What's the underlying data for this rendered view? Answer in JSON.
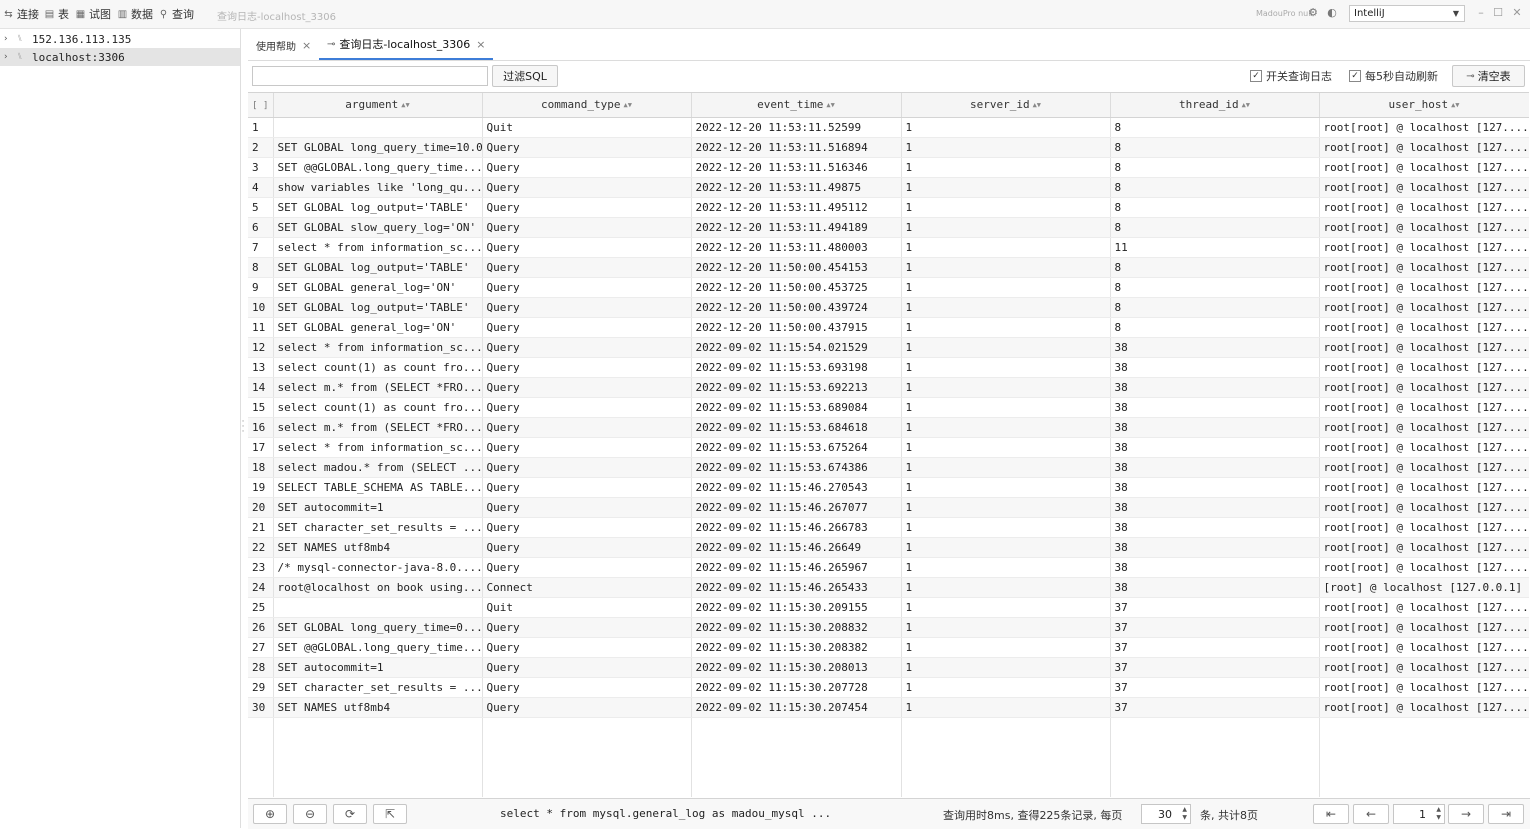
{
  "toolbar": {
    "items": [
      {
        "label": "连接",
        "icon": "connect-icon"
      },
      {
        "label": "表",
        "icon": "table-icon"
      },
      {
        "label": "试图",
        "icon": "view-icon"
      },
      {
        "label": "数据",
        "icon": "data-icon"
      },
      {
        "label": "查询",
        "icon": "query-icon"
      }
    ],
    "window_title": "查询日志-localhost_3306",
    "brand": "MadouPro null",
    "theme_value": "IntelliJ"
  },
  "tree": {
    "connections": [
      {
        "label": "152.136.113.135",
        "selected": false
      },
      {
        "label": "localhost:3306",
        "selected": true
      }
    ]
  },
  "tabs": [
    {
      "label": "使用帮助",
      "active": false
    },
    {
      "label": "查询日志-localhost_3306",
      "active": true
    }
  ],
  "filter": {
    "input_value": "",
    "button_label": "过滤SQL",
    "toggle_log_label": "开关查询日志",
    "toggle_log_checked": true,
    "auto_refresh_label": "每5秒自动刷新",
    "auto_refresh_checked": true,
    "clear_label": "清空表"
  },
  "grid": {
    "columns": [
      "argument",
      "command_type",
      "event_time",
      "server_id",
      "thread_id",
      "user_host"
    ],
    "rows": [
      [
        "1",
        "",
        "Quit",
        "2022-12-20 11:53:11.52599",
        "1",
        "8",
        "root[root] @ localhost [127...."
      ],
      [
        "2",
        "SET GLOBAL long_query_time=10.0",
        "Query",
        "2022-12-20 11:53:11.516894",
        "1",
        "8",
        "root[root] @ localhost [127...."
      ],
      [
        "3",
        "SET @@GLOBAL.long_query_time...",
        "Query",
        "2022-12-20 11:53:11.516346",
        "1",
        "8",
        "root[root] @ localhost [127...."
      ],
      [
        "4",
        "show variables like 'long_qu...",
        "Query",
        "2022-12-20 11:53:11.49875",
        "1",
        "8",
        "root[root] @ localhost [127...."
      ],
      [
        "5",
        "SET GLOBAL log_output='TABLE'",
        "Query",
        "2022-12-20 11:53:11.495112",
        "1",
        "8",
        "root[root] @ localhost [127...."
      ],
      [
        "6",
        "SET GLOBAL slow_query_log='ON'",
        "Query",
        "2022-12-20 11:53:11.494189",
        "1",
        "8",
        "root[root] @ localhost [127...."
      ],
      [
        "7",
        "select * from information_sc...",
        "Query",
        "2022-12-20 11:53:11.480003",
        "1",
        "11",
        "root[root] @ localhost [127...."
      ],
      [
        "8",
        "SET GLOBAL log_output='TABLE'",
        "Query",
        "2022-12-20 11:50:00.454153",
        "1",
        "8",
        "root[root] @ localhost [127...."
      ],
      [
        "9",
        "SET GLOBAL general_log='ON'",
        "Query",
        "2022-12-20 11:50:00.453725",
        "1",
        "8",
        "root[root] @ localhost [127...."
      ],
      [
        "10",
        "SET GLOBAL log_output='TABLE'",
        "Query",
        "2022-12-20 11:50:00.439724",
        "1",
        "8",
        "root[root] @ localhost [127...."
      ],
      [
        "11",
        "SET GLOBAL general_log='ON'",
        "Query",
        "2022-12-20 11:50:00.437915",
        "1",
        "8",
        "root[root] @ localhost [127...."
      ],
      [
        "12",
        "select * from information_sc...",
        "Query",
        "2022-09-02 11:15:54.021529",
        "1",
        "38",
        "root[root] @ localhost [127...."
      ],
      [
        "13",
        "select count(1) as count fro...",
        "Query",
        "2022-09-02 11:15:53.693198",
        "1",
        "38",
        "root[root] @ localhost [127...."
      ],
      [
        "14",
        "select m.* from (SELECT *FRO...",
        "Query",
        "2022-09-02 11:15:53.692213",
        "1",
        "38",
        "root[root] @ localhost [127...."
      ],
      [
        "15",
        "select count(1) as count fro...",
        "Query",
        "2022-09-02 11:15:53.689084",
        "1",
        "38",
        "root[root] @ localhost [127...."
      ],
      [
        "16",
        "select m.* from (SELECT *FRO...",
        "Query",
        "2022-09-02 11:15:53.684618",
        "1",
        "38",
        "root[root] @ localhost [127...."
      ],
      [
        "17",
        "select * from information_sc...",
        "Query",
        "2022-09-02 11:15:53.675264",
        "1",
        "38",
        "root[root] @ localhost [127...."
      ],
      [
        "18",
        "select madou.* from (SELECT ...",
        "Query",
        "2022-09-02 11:15:53.674386",
        "1",
        "38",
        "root[root] @ localhost [127...."
      ],
      [
        "19",
        "SELECT TABLE_SCHEMA AS TABLE...",
        "Query",
        "2022-09-02 11:15:46.270543",
        "1",
        "38",
        "root[root] @ localhost [127...."
      ],
      [
        "20",
        "SET autocommit=1",
        "Query",
        "2022-09-02 11:15:46.267077",
        "1",
        "38",
        "root[root] @ localhost [127...."
      ],
      [
        "21",
        "SET character_set_results = ...",
        "Query",
        "2022-09-02 11:15:46.266783",
        "1",
        "38",
        "root[root] @ localhost [127...."
      ],
      [
        "22",
        "SET NAMES utf8mb4",
        "Query",
        "2022-09-02 11:15:46.26649",
        "1",
        "38",
        "root[root] @ localhost [127...."
      ],
      [
        "23",
        "/* mysql-connector-java-8.0....",
        "Query",
        "2022-09-02 11:15:46.265967",
        "1",
        "38",
        "root[root] @ localhost [127...."
      ],
      [
        "24",
        "root@localhost on book using...",
        "Connect",
        "2022-09-02 11:15:46.265433",
        "1",
        "38",
        "[root] @ localhost [127.0.0.1]"
      ],
      [
        "25",
        "",
        "Quit",
        "2022-09-02 11:15:30.209155",
        "1",
        "37",
        "root[root] @ localhost [127...."
      ],
      [
        "26",
        "SET GLOBAL long_query_time=0...",
        "Query",
        "2022-09-02 11:15:30.208832",
        "1",
        "37",
        "root[root] @ localhost [127...."
      ],
      [
        "27",
        "SET @@GLOBAL.long_query_time...",
        "Query",
        "2022-09-02 11:15:30.208382",
        "1",
        "37",
        "root[root] @ localhost [127...."
      ],
      [
        "28",
        "SET autocommit=1",
        "Query",
        "2022-09-02 11:15:30.208013",
        "1",
        "37",
        "root[root] @ localhost [127...."
      ],
      [
        "29",
        "SET character_set_results = ...",
        "Query",
        "2022-09-02 11:15:30.207728",
        "1",
        "37",
        "root[root] @ localhost [127...."
      ],
      [
        "30",
        "SET NAMES utf8mb4",
        "Query",
        "2022-09-02 11:15:30.207454",
        "1",
        "37",
        "root[root] @ localhost [127...."
      ]
    ]
  },
  "bottom": {
    "sql_preview": "select * from mysql.general_log as madou_mysql ...",
    "info_prefix": "查询用时8ms, 查得225条记录, 每页",
    "page_size": "30",
    "info_suffix": "条, 共计8页",
    "current_page": "1"
  }
}
